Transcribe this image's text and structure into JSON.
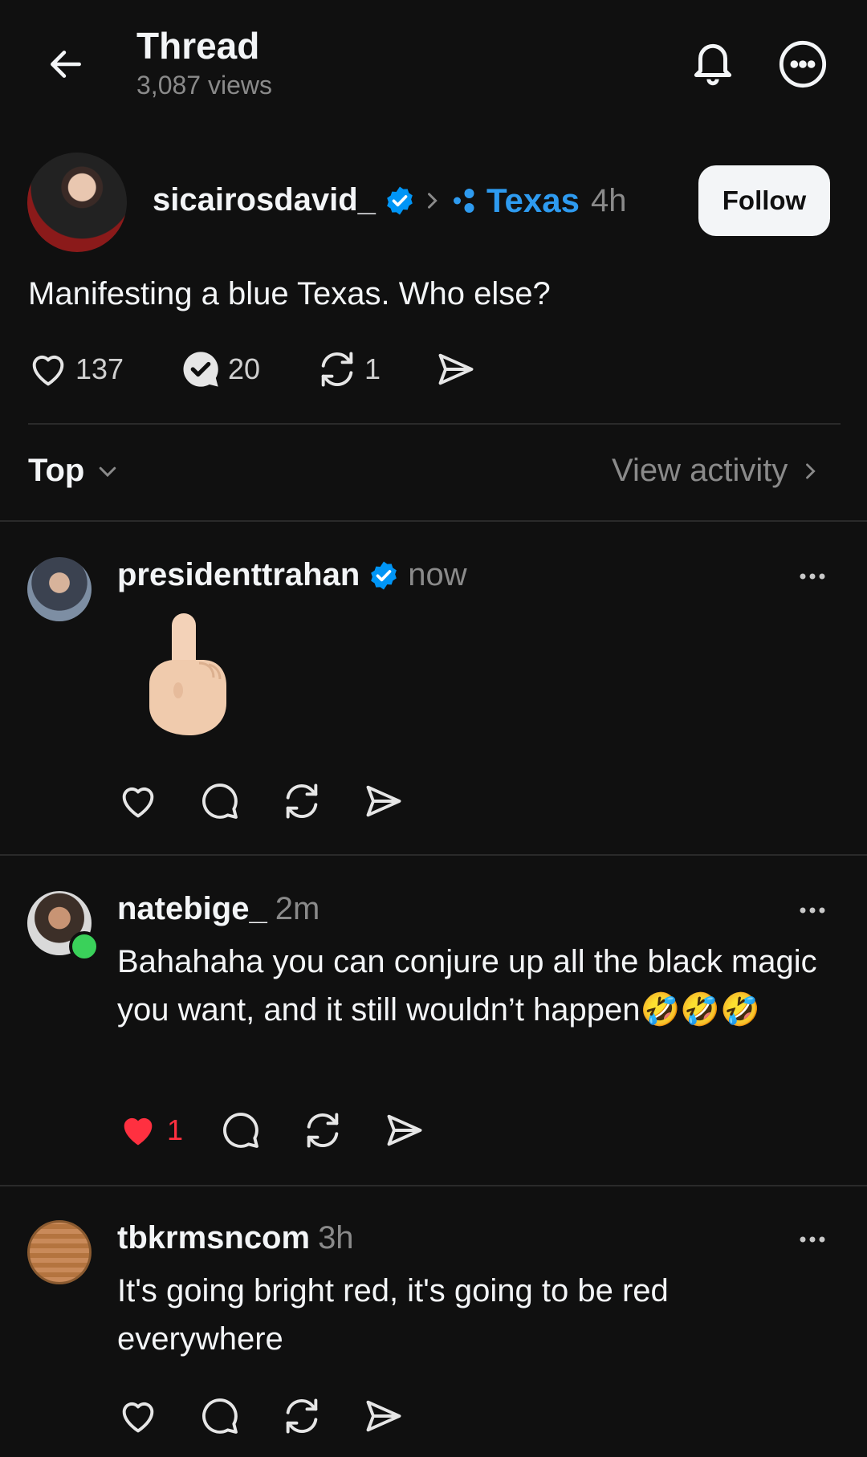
{
  "header": {
    "title": "Thread",
    "views": "3,087 views"
  },
  "op": {
    "username": "sicairosdavid_",
    "topic": "Texas",
    "time": "4h",
    "follow_label": "Follow",
    "text": "Manifesting a blue Texas. Who else?",
    "likes": "137",
    "replies": "20",
    "reposts": "1"
  },
  "sort": {
    "label": "Top",
    "activity_label": "View activity"
  },
  "replies": [
    {
      "username": "presidenttrahan",
      "verified": true,
      "time": "now",
      "content": "🖕"
    },
    {
      "username": "natebige_",
      "verified": false,
      "time": "2m",
      "text": "Bahahaha you can conjure up all the black magic you want, and it still wouldn’t happen🤣🤣🤣",
      "likes": "1",
      "liked": true
    },
    {
      "username": "tbkrmsncom",
      "verified": false,
      "time": "3h",
      "text": "It's going bright red, it's going to be red everywhere"
    }
  ],
  "colors": {
    "background": "#101010",
    "verified_blue": "#0095f6",
    "topic_blue": "#2e9bf0",
    "like_red": "#ff3040",
    "online_green": "#3ad15a"
  },
  "icons": [
    "back-arrow-icon",
    "bell-icon",
    "more-circle-icon",
    "verified-icon",
    "chevron-right-icon",
    "topic-dots-icon",
    "heart-icon",
    "reply-icon",
    "repost-icon",
    "share-icon",
    "chevron-down-icon",
    "more-horizontal-icon"
  ]
}
